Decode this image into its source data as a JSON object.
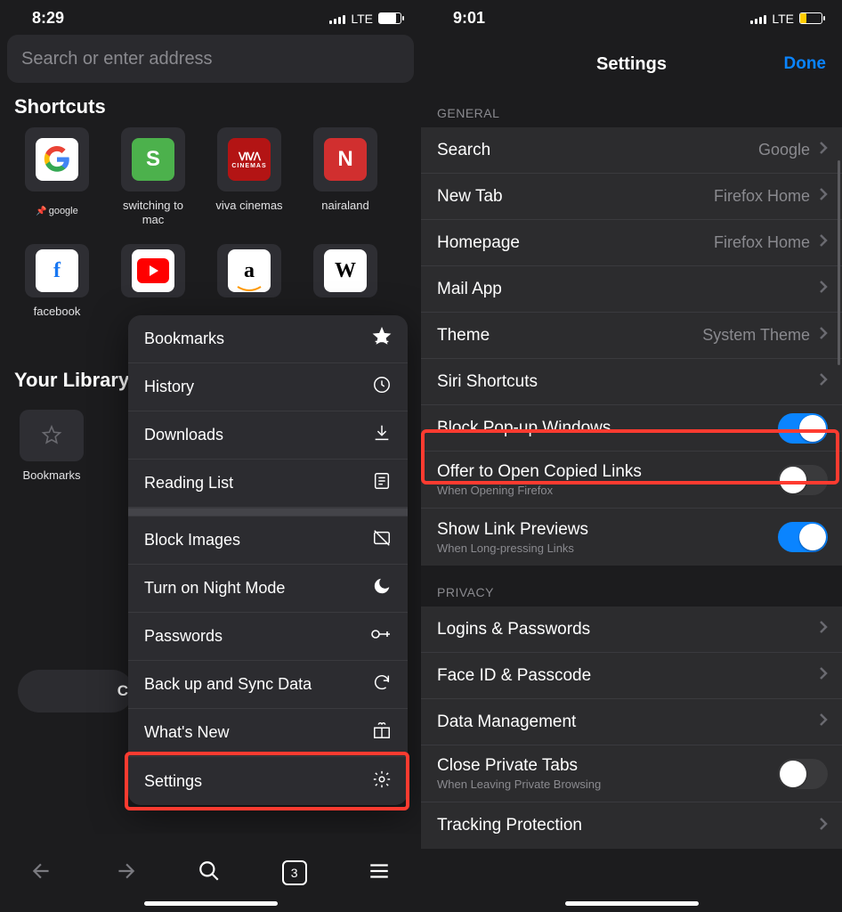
{
  "left": {
    "time": "8:29",
    "net": "LTE",
    "battery_pct": 78,
    "search_placeholder": "Search or enter address",
    "shortcuts_title": "Shortcuts",
    "shortcuts_row1": [
      {
        "label": "google",
        "pinned": true,
        "bg": "#fff",
        "icon": "G"
      },
      {
        "label": "switching to mac",
        "bg": "#4cb14c",
        "icon": "S"
      },
      {
        "label": "viva cinemas",
        "bg": "#b31414",
        "icon": "VIVA"
      },
      {
        "label": "nairaland",
        "bg": "#d12f2f",
        "icon": "N"
      }
    ],
    "shortcuts_row2": [
      {
        "label": "facebook",
        "bg": "#fff",
        "icon": "f"
      },
      {
        "label": "",
        "bg": "#fff",
        "icon": "▶"
      },
      {
        "label": "",
        "bg": "#fff",
        "icon": "a"
      },
      {
        "label": "",
        "bg": "#fff",
        "icon": "W"
      }
    ],
    "library_title": "Your Library",
    "library_items": [
      {
        "label": "Bookmarks"
      }
    ],
    "menu": [
      {
        "label": "Bookmarks",
        "icon": "star"
      },
      {
        "label": "History",
        "icon": "clock"
      },
      {
        "label": "Downloads",
        "icon": "download"
      },
      {
        "label": "Reading List",
        "icon": "book"
      },
      {
        "sep": true
      },
      {
        "label": "Block Images",
        "icon": "noimg"
      },
      {
        "label": "Turn on Night Mode",
        "icon": "moon"
      },
      {
        "label": "Passwords",
        "icon": "key"
      },
      {
        "label": "Back up and Sync Data",
        "icon": "sync"
      },
      {
        "label": "What's New",
        "icon": "gift"
      },
      {
        "label": "Settings",
        "icon": "gear",
        "highlight": true
      }
    ],
    "tab_count": "3",
    "pill_fragment": "C"
  },
  "right": {
    "time": "9:01",
    "net": "LTE",
    "battery_pct": 28,
    "title": "Settings",
    "done": "Done",
    "general_header": "GENERAL",
    "privacy_header": "PRIVACY",
    "rows_general": [
      {
        "label": "Search",
        "value": "Google",
        "chevron": true
      },
      {
        "label": "New Tab",
        "value": "Firefox Home",
        "chevron": true
      },
      {
        "label": "Homepage",
        "value": "Firefox Home",
        "chevron": true
      },
      {
        "label": "Mail App",
        "chevron": true
      },
      {
        "label": "Theme",
        "value": "System Theme",
        "chevron": true
      },
      {
        "label": "Siri Shortcuts",
        "chevron": true
      },
      {
        "label": "Block Pop-up Windows",
        "toggle": true,
        "on": true,
        "highlight": true
      },
      {
        "label": "Offer to Open Copied Links",
        "sub": "When Opening Firefox",
        "toggle": true,
        "on": false
      },
      {
        "label": "Show Link Previews",
        "sub": "When Long-pressing Links",
        "toggle": true,
        "on": true
      }
    ],
    "rows_privacy": [
      {
        "label": "Logins & Passwords",
        "chevron": true
      },
      {
        "label": "Face ID & Passcode",
        "chevron": true
      },
      {
        "label": "Data Management",
        "chevron": true
      },
      {
        "label": "Close Private Tabs",
        "sub": "When Leaving Private Browsing",
        "toggle": true,
        "on": false
      },
      {
        "label": "Tracking Protection",
        "chevron": true
      }
    ]
  }
}
